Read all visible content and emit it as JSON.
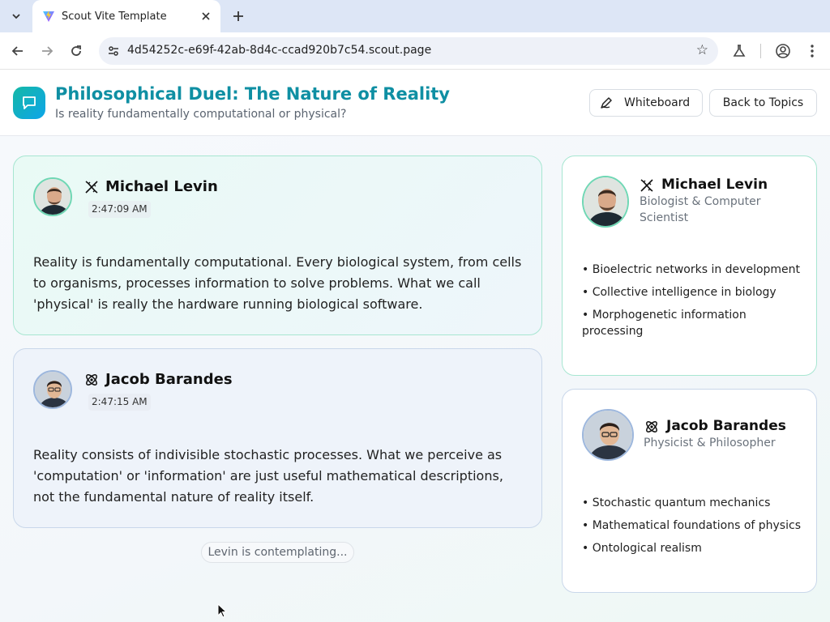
{
  "browser": {
    "tab_title": "Scout Vite Template",
    "url": "4d54252c-e69f-42ab-8d4c-ccad920b7c54.scout.page"
  },
  "app": {
    "title": "Philosophical Duel: The Nature of Reality",
    "subtitle": "Is reality fundamentally computational or physical?",
    "whiteboard_label": "Whiteboard",
    "back_label": "Back to Topics"
  },
  "messages": [
    {
      "speaker": "Michael Levin",
      "time": "2:47:09 AM",
      "text": "Reality is fundamentally computational. Every biological system, from cells to organisms, processes information to solve problems. What we call 'physical' is really the hardware running biological software."
    },
    {
      "speaker": "Jacob Barandes",
      "time": "2:47:15 AM",
      "text": "Reality consists of indivisible stochastic processes. What we perceive as 'computation' or 'information' are just useful mathematical descriptions, not the fundamental nature of reality itself."
    }
  ],
  "status": "Levin is contemplating...",
  "profiles": [
    {
      "name": "Michael Levin",
      "role": "Biologist & Computer Scientist",
      "topics": [
        "• Bioelectric networks in development",
        "• Collective intelligence in biology",
        "• Morphogenetic information processing"
      ]
    },
    {
      "name": "Jacob Barandes",
      "role": "Physicist & Philosopher",
      "topics": [
        "• Stochastic quantum mechanics",
        "• Mathematical foundations of physics",
        "• Ontological realism"
      ]
    }
  ],
  "colors": {
    "accent": "#0f8fa3",
    "levin_border": "#a7e6d1",
    "barandes_border": "#c9d7ea"
  },
  "icons": {
    "levin": "dna-icon",
    "barandes": "atom-icon"
  }
}
